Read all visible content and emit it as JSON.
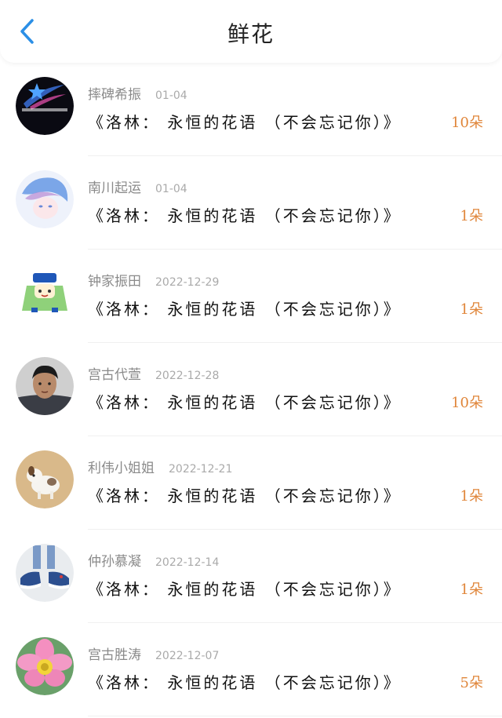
{
  "header": {
    "title": "鲜花"
  },
  "list": [
    {
      "username": "摔碑希振",
      "date": "01-04",
      "message": "《洛林： 永恒的花语 （不会忘记你）》",
      "count": "10朵"
    },
    {
      "username": "南川起运",
      "date": "01-04",
      "message": "《洛林： 永恒的花语 （不会忘记你）》",
      "count": "1朵"
    },
    {
      "username": "钟家振田",
      "date": "2022-12-29",
      "message": "《洛林： 永恒的花语 （不会忘记你）》",
      "count": "1朵"
    },
    {
      "username": "宫古代萱",
      "date": "2022-12-28",
      "message": "《洛林： 永恒的花语 （不会忘记你）》",
      "count": "10朵"
    },
    {
      "username": "利伟小姐姐",
      "date": "2022-12-21",
      "message": "《洛林： 永恒的花语 （不会忘记你）》",
      "count": "1朵"
    },
    {
      "username": "仲孙慕凝",
      "date": "2022-12-14",
      "message": "《洛林： 永恒的花语 （不会忘记你）》",
      "count": "1朵"
    },
    {
      "username": "宫古胜涛",
      "date": "2022-12-07",
      "message": "《洛林： 永恒的花语 （不会忘记你）》",
      "count": "5朵"
    }
  ],
  "colors": {
    "accent": "#2b8fe6",
    "count": "#e0863a"
  },
  "icons": {
    "back": "chevron-left-icon"
  }
}
